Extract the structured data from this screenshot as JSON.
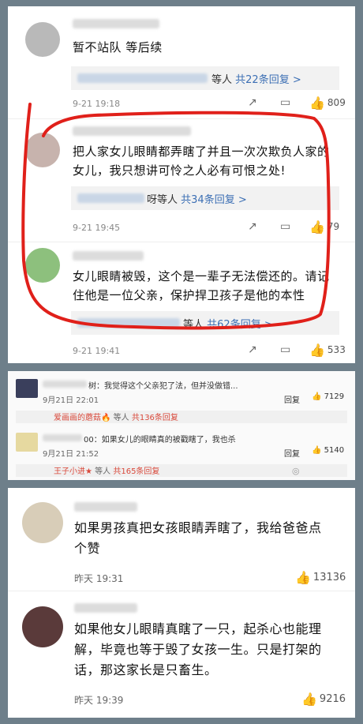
{
  "panel1": {
    "c1": {
      "text": "暂不站队 等后续",
      "reply_suffix": "等人",
      "reply_count": "共22条回复 >",
      "time": "9-21 19:18",
      "likes": "809"
    },
    "c2": {
      "text": "把人家女儿眼睛都弄瞎了并且一次次欺负人家的女儿，我只想讲可怜之人必有可恨之处!",
      "reply_suffix": "呀等人",
      "reply_count": "共34条回复 >",
      "time": "9-21 19:45",
      "likes": "79"
    },
    "c3": {
      "text": "女儿眼睛被毁，这个是一辈子无法偿还的。请记住他是一位父亲，保护捍卫孩子是他的本性",
      "reply_suffix": "等人",
      "reply_count": "共62条回复 >",
      "time": "9-21 19:41",
      "likes": "533"
    }
  },
  "panel2": {
    "r1": {
      "text": "树：我觉得这个父亲犯了法，但并没做错...",
      "time": "9月21日 22:01",
      "reply": "回复",
      "likes": "7129",
      "sub_name": "爱画画的蘑菇",
      "sub_mid": "等人",
      "sub_count": "共136条回复"
    },
    "r2": {
      "text": "00：如果女儿的眼睛真的被戳瞎了，我也杀",
      "time": "9月21日 21:52",
      "reply": "回复",
      "likes": "5140",
      "sub_name": "王子小进",
      "sub_mid": "等人",
      "sub_count": "共165条回复"
    }
  },
  "panel3": {
    "c1": {
      "text": "如果男孩真把女孩眼睛弄瞎了，我给爸爸点个赞",
      "time": "昨天 19:31",
      "likes": "13136"
    },
    "c2": {
      "text": "如果他女儿眼睛真瞎了一只，起杀心也能理解，毕竟也等于毁了女孩一生。只是打架的话，那这家长是只畜生。",
      "time": "昨天 19:39",
      "likes": "9216"
    }
  },
  "colors": {
    "link": "#3c6fb4",
    "annotation": "#e0201a"
  }
}
